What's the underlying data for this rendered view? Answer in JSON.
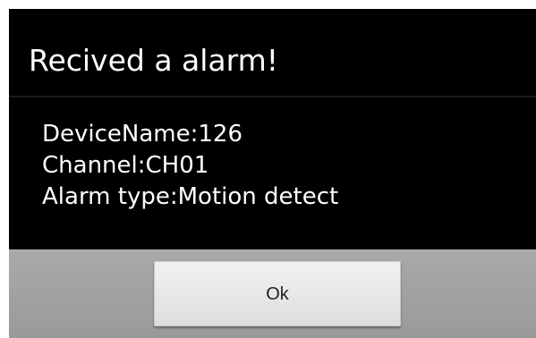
{
  "dialog": {
    "title": "Recived a alarm!",
    "message_lines": [
      "DeviceName:126",
      "Channel:CH01",
      "Alarm type:Motion detect"
    ],
    "ok_label": "Ok"
  },
  "colors": {
    "dialog_background": "#000000",
    "text": "#ffffff",
    "button_bar": "#a0a0a0",
    "button": "#e8e8e8"
  }
}
